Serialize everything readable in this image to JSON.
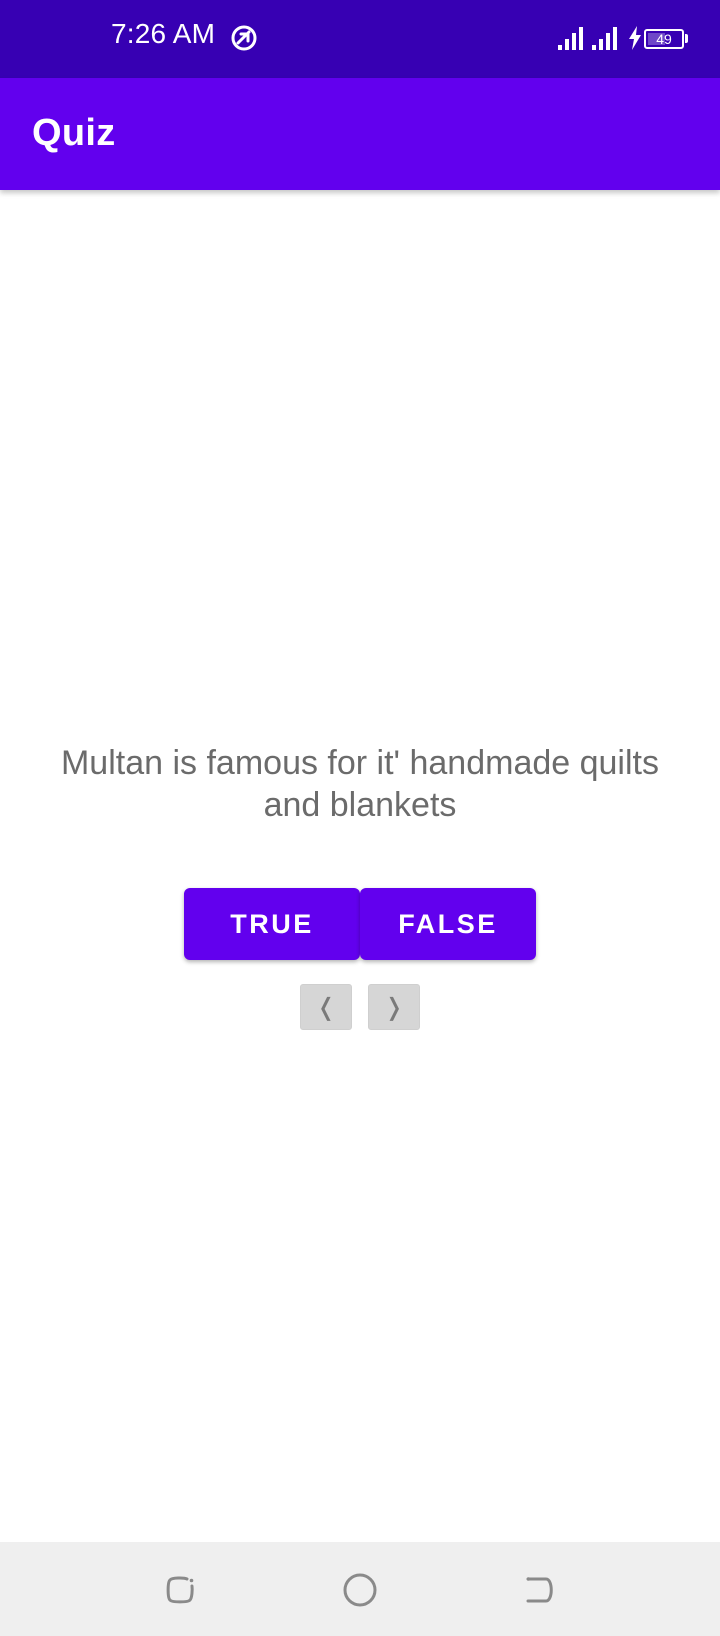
{
  "status_bar": {
    "time": "7:26 AM",
    "battery_level": "49",
    "background_color": "#3700b3",
    "icons": [
      "sync-icon",
      "signal-icon",
      "signal-icon",
      "charging-icon",
      "battery-icon"
    ]
  },
  "app_bar": {
    "title": "Quiz",
    "background_color": "#6200ee"
  },
  "question": {
    "text": "Multan is famous for it' handmade quilts and blankets"
  },
  "buttons": {
    "true_label": "TRUE",
    "false_label": "FALSE",
    "prev_label": "❬",
    "next_label": "❭",
    "accent_color": "#6200ee"
  },
  "nav_bar": {
    "icons": [
      "recents-icon",
      "home-icon",
      "back-icon"
    ]
  }
}
